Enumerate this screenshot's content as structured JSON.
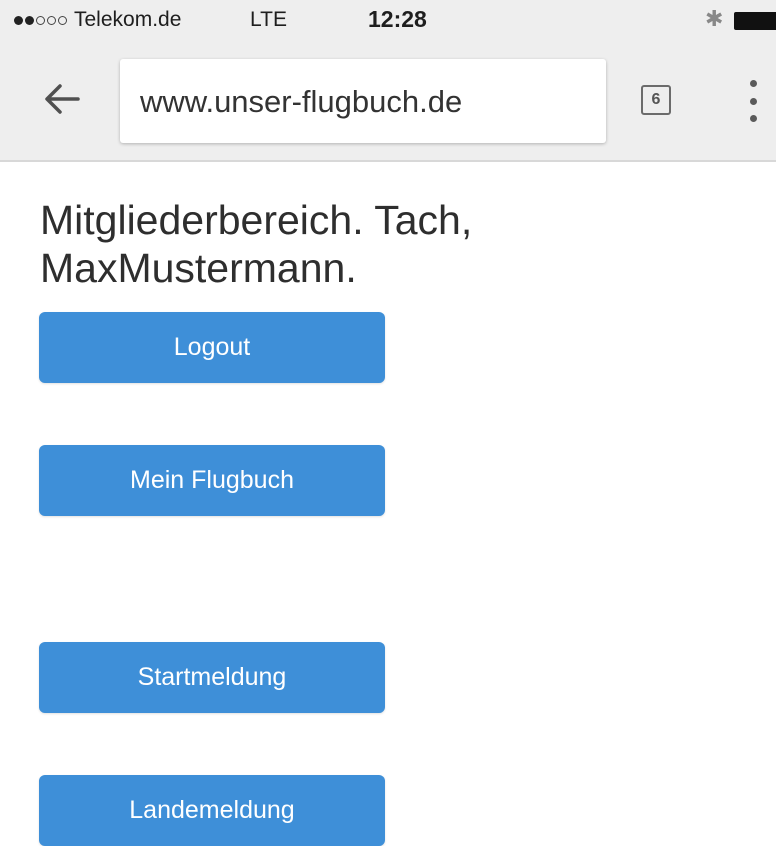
{
  "status_bar": {
    "carrier": "Telekom.de",
    "network": "LTE",
    "time": "12:28",
    "signal_strength": 2,
    "signal_max": 5,
    "bluetooth_icon": "bluetooth-icon",
    "battery_icon": "battery-icon"
  },
  "browser": {
    "url": "www.unser-flugbuch.de",
    "tab_count": "6",
    "back_icon": "back-arrow-icon",
    "menu_icon": "overflow-menu-icon"
  },
  "page": {
    "heading": "Mitgliederbereich. Tach, MaxMustermann.",
    "buttons": {
      "logout": "Logout",
      "flugbuch": "Mein Flugbuch",
      "startmeldung": "Startmeldung",
      "landemeldung": "Landemeldung"
    }
  },
  "colors": {
    "button_bg": "#3e8fd8",
    "button_text": "#ffffff",
    "toolbar_bg": "#eeeeee"
  }
}
